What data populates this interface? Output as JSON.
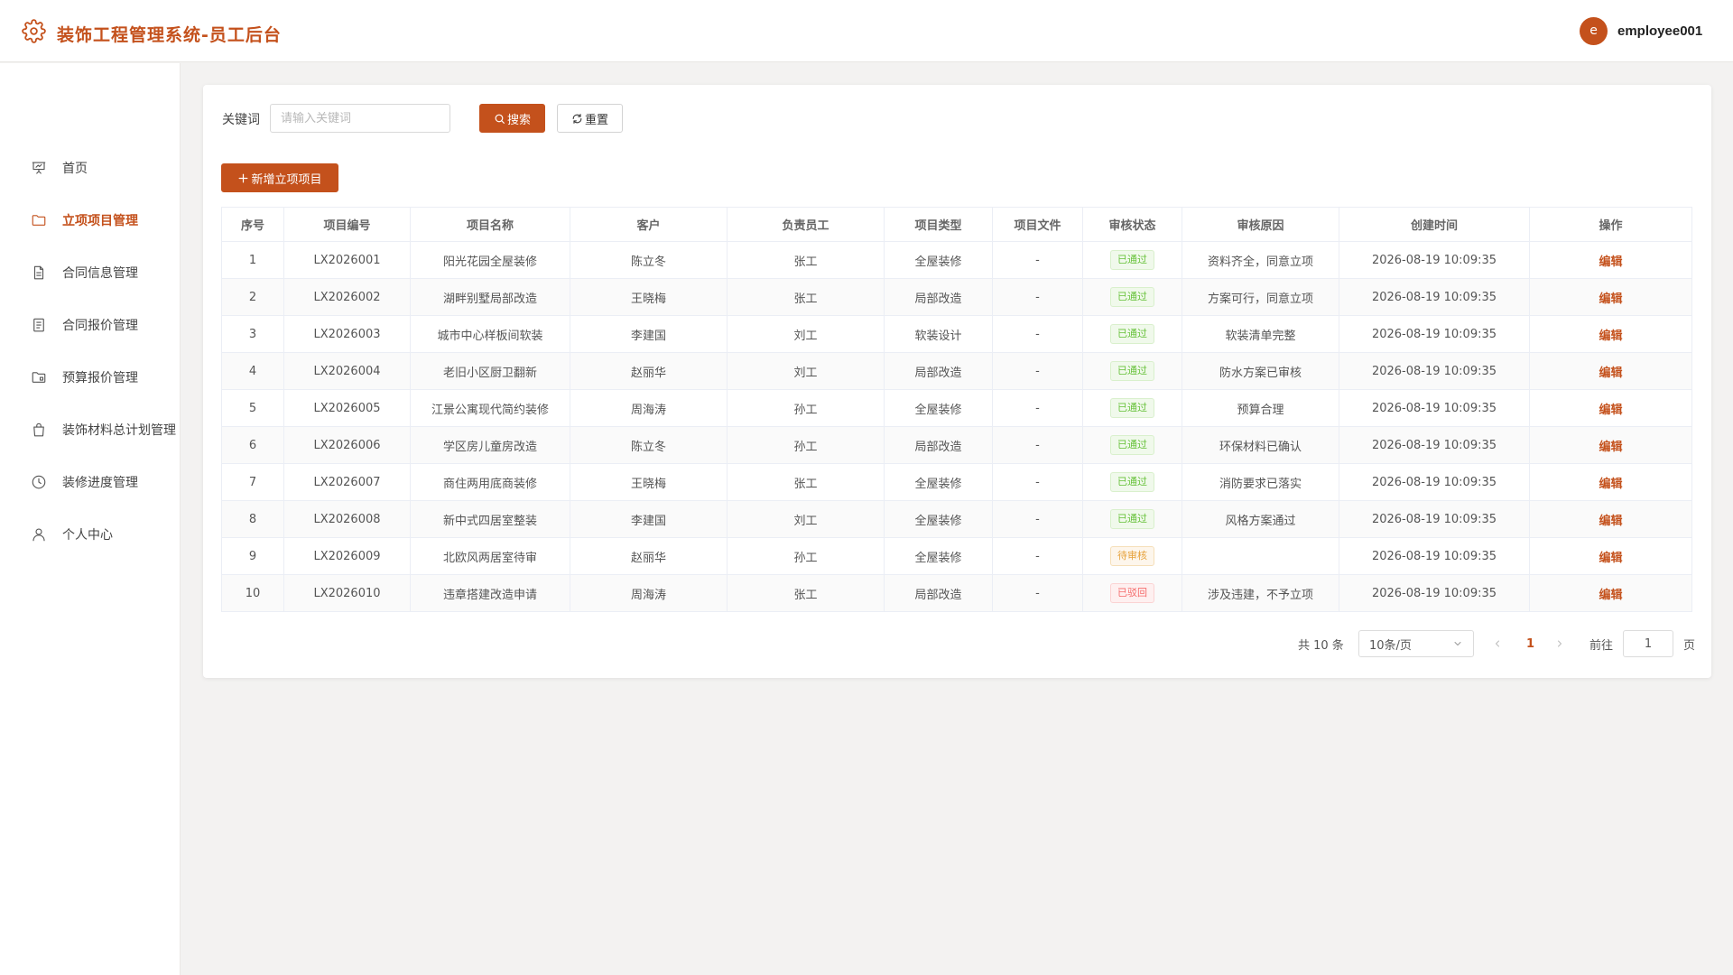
{
  "header": {
    "title": "装饰工程管理系统-员工后台",
    "avatar_letter": "e",
    "username": "employee001"
  },
  "sidebar": {
    "items": [
      {
        "label": "首页",
        "icon": "presentation-icon"
      },
      {
        "label": "立项项目管理",
        "icon": "folder-icon",
        "active": true
      },
      {
        "label": "合同信息管理",
        "icon": "document-icon"
      },
      {
        "label": "合同报价管理",
        "icon": "list-document-icon"
      },
      {
        "label": "预算报价管理",
        "icon": "folder-open-icon"
      },
      {
        "label": "装饰材料总计划管理",
        "icon": "shopping-bag-icon"
      },
      {
        "label": "装修进度管理",
        "icon": "clock-icon"
      },
      {
        "label": "个人中心",
        "icon": "user-icon"
      }
    ]
  },
  "search": {
    "label": "关键词",
    "placeholder": "请输入关键词",
    "value": "",
    "search_label": "搜索",
    "reset_label": "重置",
    "add_label": "新增立项项目"
  },
  "table": {
    "columns": [
      "序号",
      "项目编号",
      "项目名称",
      "客户",
      "负责员工",
      "项目类型",
      "项目文件",
      "审核状态",
      "审核原因",
      "创建时间",
      "操作"
    ],
    "rows": [
      [
        "1",
        "LX2026001",
        "阳光花园全屋装修",
        "陈立冬",
        "张工",
        "全屋装修",
        "-",
        "已通过",
        "资料齐全，同意立项",
        "2026-08-19 10:09:35",
        "编辑"
      ],
      [
        "2",
        "LX2026002",
        "湖畔别墅局部改造",
        "王晓梅",
        "张工",
        "局部改造",
        "-",
        "已通过",
        "方案可行，同意立项",
        "2026-08-19 10:09:35",
        "编辑"
      ],
      [
        "3",
        "LX2026003",
        "城市中心样板间软装",
        "李建国",
        "刘工",
        "软装设计",
        "-",
        "已通过",
        "软装清单完整",
        "2026-08-19 10:09:35",
        "编辑"
      ],
      [
        "4",
        "LX2026004",
        "老旧小区厨卫翻新",
        "赵丽华",
        "刘工",
        "局部改造",
        "-",
        "已通过",
        "防水方案已审核",
        "2026-08-19 10:09:35",
        "编辑"
      ],
      [
        "5",
        "LX2026005",
        "江景公寓现代简约装修",
        "周海涛",
        "孙工",
        "全屋装修",
        "-",
        "已通过",
        "预算合理",
        "2026-08-19 10:09:35",
        "编辑"
      ],
      [
        "6",
        "LX2026006",
        "学区房儿童房改造",
        "陈立冬",
        "孙工",
        "局部改造",
        "-",
        "已通过",
        "环保材料已确认",
        "2026-08-19 10:09:35",
        "编辑"
      ],
      [
        "7",
        "LX2026007",
        "商住两用底商装修",
        "王晓梅",
        "张工",
        "全屋装修",
        "-",
        "已通过",
        "消防要求已落实",
        "2026-08-19 10:09:35",
        "编辑"
      ],
      [
        "8",
        "LX2026008",
        "新中式四居室整装",
        "李建国",
        "刘工",
        "全屋装修",
        "-",
        "已通过",
        "风格方案通过",
        "2026-08-19 10:09:35",
        "编辑"
      ],
      [
        "9",
        "LX2026009",
        "北欧风两居室待审",
        "赵丽华",
        "孙工",
        "全屋装修",
        "-",
        "待审核",
        "",
        "2026-08-19 10:09:35",
        "编辑"
      ],
      [
        "10",
        "LX2026010",
        "违章搭建改造申请",
        "周海涛",
        "张工",
        "局部改造",
        "-",
        "已驳回",
        "涉及违建，不予立项",
        "2026-08-19 10:09:35",
        "编辑"
      ]
    ]
  },
  "pagination": {
    "total": "共 10 条",
    "page_size": "10条/页",
    "current": "1",
    "goto_label": "前往",
    "goto_value": "1",
    "page_label": "页"
  },
  "colors": {
    "accent": "#c4511c",
    "status_pass": "#67c23a",
    "status_pending": "#e6a23c",
    "status_reject": "#f56c6c"
  }
}
